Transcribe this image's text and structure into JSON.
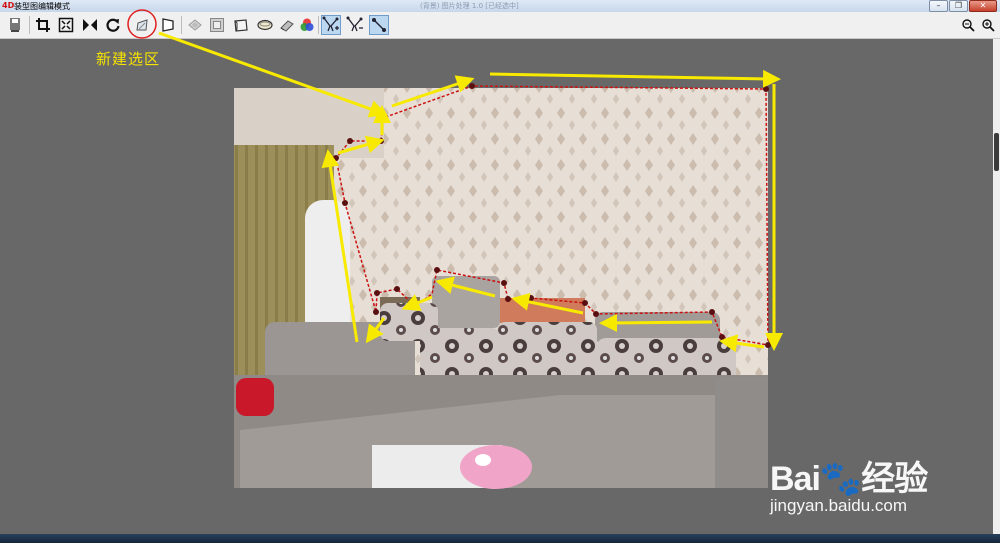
{
  "window": {
    "logo_glyph": "4D",
    "title": "装型图编辑模式",
    "faint_title": "(背景) 图片处理 1.0  [已经选中]"
  },
  "window_buttons": {
    "minimize": "–",
    "restore": "❐",
    "close": "✕"
  },
  "toolbar": {
    "tools": [
      {
        "icon": "save-icon",
        "active": false
      },
      {
        "icon": "crop-icon",
        "active": false
      },
      {
        "icon": "fit-icon",
        "active": false
      },
      {
        "icon": "flip-icon",
        "active": false
      },
      {
        "icon": "rotate-icon",
        "active": false
      },
      {
        "icon": "new-selection-icon",
        "active": false,
        "highlighted": true
      },
      {
        "icon": "perspective-icon",
        "active": false
      },
      {
        "icon": "diamond-icon",
        "active": false
      },
      {
        "icon": "frame-icon",
        "active": false
      },
      {
        "icon": "box-icon",
        "active": false
      },
      {
        "icon": "ellipse-icon",
        "active": false
      },
      {
        "icon": "eraser-icon",
        "active": false
      },
      {
        "icon": "color-icon",
        "active": false
      },
      {
        "icon": "select-add-icon",
        "active": true
      },
      {
        "icon": "select-remove-icon",
        "active": false
      },
      {
        "icon": "node-edit-icon",
        "active": true
      }
    ],
    "right_tools": [
      {
        "icon": "zoom-out-icon"
      },
      {
        "icon": "zoom-in-icon"
      }
    ]
  },
  "annotation": {
    "caption": "新建选区",
    "arrow_color": "#f7ea00",
    "circle_color": "#e02020"
  },
  "selection": {
    "outline_color": "#cc1111",
    "node_color": "#5a1010"
  },
  "watermark": {
    "logo": "Bai🐾经验",
    "url": "jingyan.baidu.com"
  }
}
